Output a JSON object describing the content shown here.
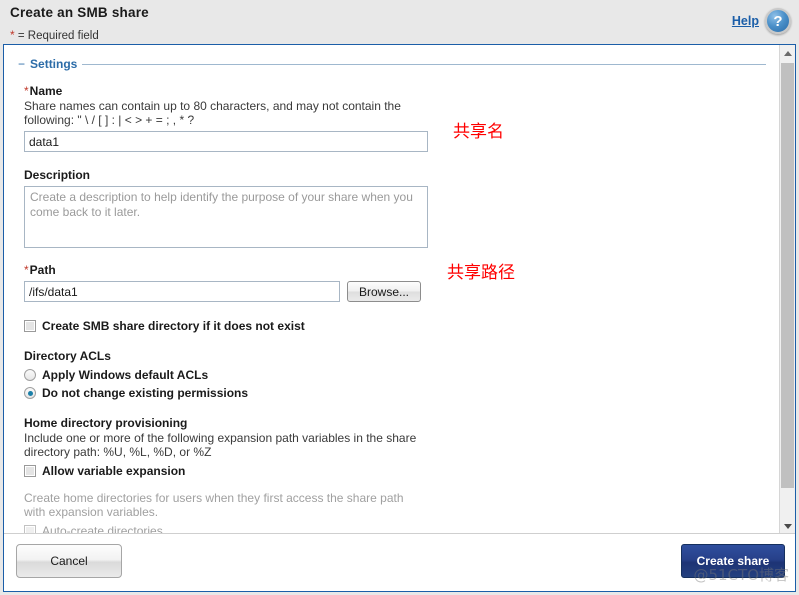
{
  "header": {
    "title": "Create an SMB share",
    "required_note": "= Required field",
    "required_star": "*",
    "help_label": "Help",
    "help_icon": "question-mark-circle-icon"
  },
  "settings": {
    "legend": "Settings",
    "name": {
      "label": "Name",
      "required_star": "*",
      "description": "Share names can contain up to 80 characters, and may not contain the following: \" \\ / [ ] : | < > + = ; , * ?",
      "value": "data1",
      "annotation": "共享名"
    },
    "description": {
      "label": "Description",
      "value": "",
      "placeholder": "Create a description to help identify the purpose of your share when you come back to it later."
    },
    "path": {
      "label": "Path",
      "required_star": "*",
      "value": "/ifs/data1",
      "browse_label": "Browse...",
      "annotation": "共享路径"
    },
    "create_dir_checkbox": {
      "label": "Create SMB share directory if it does not exist",
      "checked": false
    },
    "directory_acls": {
      "heading": "Directory ACLs",
      "options": [
        {
          "label": "Apply Windows default ACLs",
          "selected": false
        },
        {
          "label": "Do not change existing permissions",
          "selected": true
        }
      ]
    },
    "home_directory": {
      "heading": "Home directory provisioning",
      "description": "Include one or more of the following expansion path variables in the share directory path: %U, %L, %D, or %Z",
      "allow_variable_expansion": {
        "label": "Allow variable expansion",
        "checked": false
      },
      "auto_create_note": "Create home directories for users when they first access the share path with expansion variables.",
      "auto_create_directories": {
        "label": "Auto-create directories",
        "checked": false,
        "disabled": true
      }
    }
  },
  "footer": {
    "cancel_label": "Cancel",
    "create_label": "Create share"
  },
  "watermark": "@51CTO博客",
  "colors": {
    "accent": "#1b5ea8",
    "primary_button": "#27408a",
    "required": "#c0392b",
    "annotation": "#ff0000"
  }
}
